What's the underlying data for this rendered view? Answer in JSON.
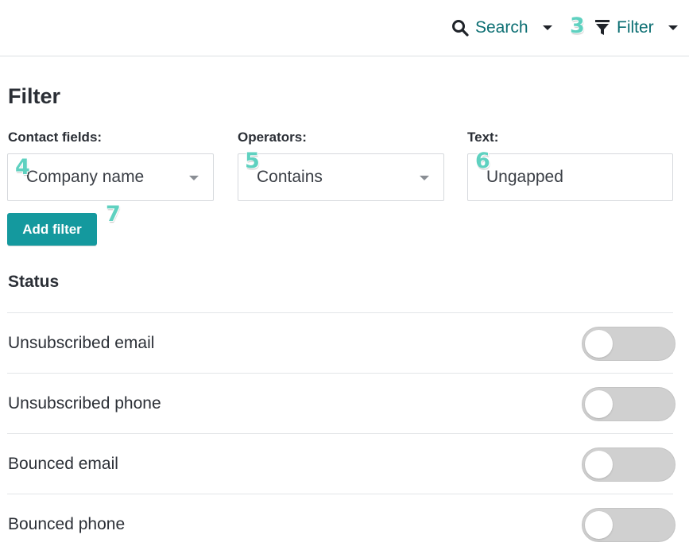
{
  "topbar": {
    "search_label": "Search",
    "filter_label": "Filter",
    "search_icon": "search-icon",
    "filter_icon": "funnel-icon"
  },
  "markers": {
    "filter": "3",
    "contact": "4",
    "operator": "5",
    "text": "6",
    "add": "7"
  },
  "filter_panel": {
    "heading": "Filter",
    "contact_fields": {
      "label": "Contact fields:",
      "value": "Company name"
    },
    "operators": {
      "label": "Operators:",
      "value": "Contains"
    },
    "text": {
      "label": "Text:",
      "value": "Ungapped"
    },
    "add_filter_label": "Add filter"
  },
  "status": {
    "title": "Status",
    "items": [
      {
        "label": "Unsubscribed email",
        "on": false
      },
      {
        "label": "Unsubscribed phone",
        "on": false
      },
      {
        "label": "Bounced email",
        "on": false
      },
      {
        "label": "Bounced phone",
        "on": false
      }
    ]
  },
  "colors": {
    "accent": "#14999e",
    "link": "#0b6e72",
    "marker": "#5fd1c0",
    "toggle_off": "#d0d0d0"
  }
}
